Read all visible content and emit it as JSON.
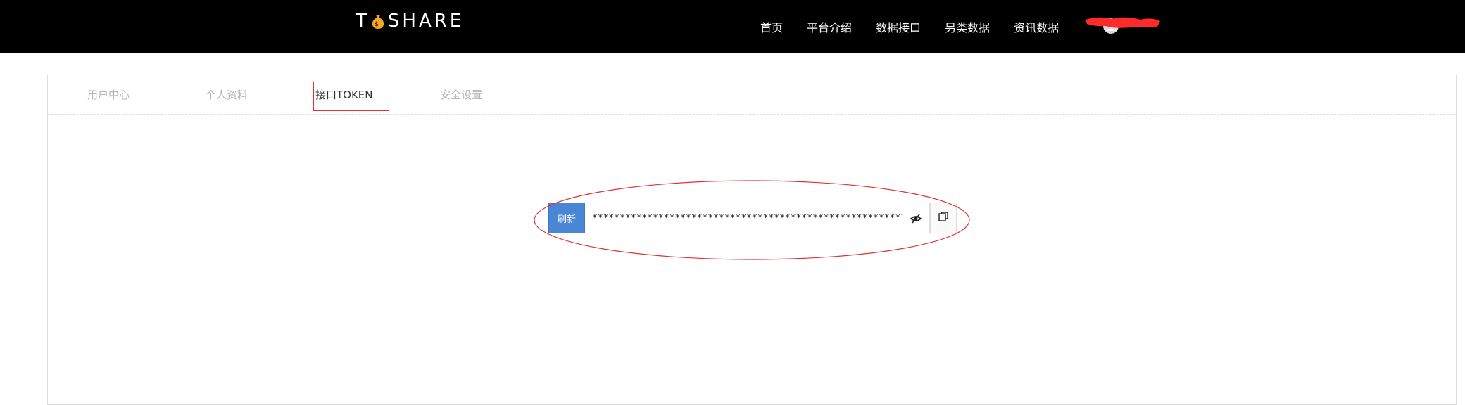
{
  "header": {
    "logo_prefix": "T",
    "logo_suffix": "SHARE",
    "logo_icon": "coin-bag-icon",
    "brand_color": "#f5a623",
    "nav_items": [
      {
        "label": "首页"
      },
      {
        "label": "平台介绍"
      },
      {
        "label": "数据接口"
      },
      {
        "label": "另类数据"
      },
      {
        "label": "资讯数据"
      }
    ],
    "avatar_icon": "user-avatar-icon",
    "redaction_color": "#ff2a2a"
  },
  "tabs": [
    {
      "label": "用户中心",
      "active": false
    },
    {
      "label": "个人资料",
      "active": false
    },
    {
      "label": "接口TOKEN",
      "active": true
    },
    {
      "label": "安全设置",
      "active": false
    }
  ],
  "token": {
    "refresh_label": "刷新",
    "value": "*****************************************************************",
    "toggle_icon": "eye-slash-icon",
    "copy_icon": "copy-icon",
    "button_color": "#4a86d6"
  },
  "annotation_color": "#e03131"
}
